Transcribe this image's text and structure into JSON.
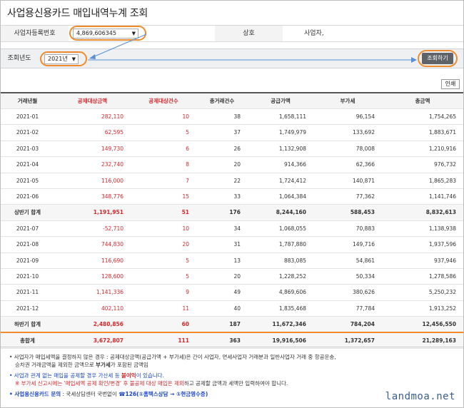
{
  "page": {
    "title": "사업용신용카드 매입내역누계 조회"
  },
  "search": {
    "biz_no_label": "사업자등록번호",
    "biz_no_value": "4,869,606345",
    "company_label": "상호",
    "company_value": "사업자,",
    "year_label": "조회년도",
    "year_value": "2021년",
    "search_button": "조회하기",
    "print_button": "인쇄"
  },
  "table": {
    "headers": [
      "거래년월",
      "공제대상금액",
      "공제대상건수",
      "총거래건수",
      "공급가액",
      "부가세",
      "총금액"
    ],
    "rows": [
      {
        "ym": "2021-01",
        "amt": "282,110",
        "cnt": "10",
        "total_cnt": "38",
        "supply": "1,658,111",
        "vat": "96,154",
        "total": "1,754,265",
        "type": "normal"
      },
      {
        "ym": "2021-02",
        "amt": "62,595",
        "cnt": "5",
        "total_cnt": "37",
        "supply": "1,749,979",
        "vat": "133,692",
        "total": "1,883,671",
        "type": "normal"
      },
      {
        "ym": "2021-03",
        "amt": "149,730",
        "cnt": "6",
        "total_cnt": "26",
        "supply": "1,132,908",
        "vat": "78,008",
        "total": "1,210,916",
        "type": "normal"
      },
      {
        "ym": "2021-04",
        "amt": "232,740",
        "cnt": "8",
        "total_cnt": "20",
        "supply": "914,366",
        "vat": "62,366",
        "total": "976,732",
        "type": "normal"
      },
      {
        "ym": "2021-05",
        "amt": "116,000",
        "cnt": "7",
        "total_cnt": "22",
        "supply": "1,724,412",
        "vat": "140,871",
        "total": "1,865,283",
        "type": "normal"
      },
      {
        "ym": "2021-06",
        "amt": "348,776",
        "cnt": "15",
        "total_cnt": "33",
        "supply": "1,064,384",
        "vat": "77,362",
        "total": "1,141,746",
        "type": "normal"
      },
      {
        "ym": "상반기 합계",
        "amt": "1,191,951",
        "cnt": "51",
        "total_cnt": "176",
        "supply": "8,244,160",
        "vat": "588,453",
        "total": "8,832,613",
        "type": "sum"
      },
      {
        "ym": "2021-07",
        "amt": "-52,710",
        "cnt": "10",
        "total_cnt": "34",
        "supply": "1,068,055",
        "vat": "70,883",
        "total": "1,138,938",
        "type": "normal"
      },
      {
        "ym": "2021-08",
        "amt": "744,830",
        "cnt": "20",
        "total_cnt": "31",
        "supply": "1,787,880",
        "vat": "149,716",
        "total": "1,937,596",
        "type": "normal"
      },
      {
        "ym": "2021-09",
        "amt": "116,690",
        "cnt": "5",
        "total_cnt": "13",
        "supply": "883,085",
        "vat": "54,861",
        "total": "937,946",
        "type": "normal"
      },
      {
        "ym": "2021-10",
        "amt": "128,600",
        "cnt": "5",
        "total_cnt": "20",
        "supply": "1,228,252",
        "vat": "50,334",
        "total": "1,278,586",
        "type": "normal"
      },
      {
        "ym": "2021-11",
        "amt": "1,141,336",
        "cnt": "9",
        "total_cnt": "49",
        "supply": "4,869,606",
        "vat": "380,626",
        "total": "5,250,232",
        "type": "normal"
      },
      {
        "ym": "2021-12",
        "amt": "402,110",
        "cnt": "11",
        "total_cnt": "40",
        "supply": "1,835,468",
        "vat": "77,784",
        "total": "1,913,252",
        "type": "normal"
      },
      {
        "ym": "하반기 합계",
        "amt": "2,480,856",
        "cnt": "60",
        "total_cnt": "187",
        "supply": "11,672,346",
        "vat": "784,204",
        "total": "12,456,550",
        "type": "sum-orange"
      },
      {
        "ym": "총합계",
        "amt": "3,672,807",
        "cnt": "111",
        "total_cnt": "363",
        "supply": "19,916,506",
        "vat": "1,372,657",
        "total": "21,289,163",
        "type": "sum"
      }
    ]
  },
  "notes": {
    "n1": "• 사업자가 매입세액을 결정하지 않은 경우 : 공제대상금액(공급가액 + 부가세)은 간이 사업자, 면세사업자 거래분과 일반사업자 거래 중 항공운송,",
    "n2_a": "승차권 거래금액을 제외한 금액으로 ",
    "n2_b": "부가세",
    "n2_c": "가 포함된 금액임",
    "n3_a": "• 사업과 관계 없는 매입을 공제할 경우 가산세 등 ",
    "n3_b": "불이익",
    "n3_c": "이 있습니다.",
    "n4_a": "※ 부가세 신고시에는 '매입세액 공제 확인/변경' 후 불공제 대상 매입은 제외",
    "n4_b": "하고 공제할 금액과 세액만 입력하여야 합니다.",
    "n5_a": "• 사업용신용카드 문의",
    "n5_b": " : 국세상담센터 국번없이 ",
    "n5_c": "☎126(①홈택스상담 → ①현금영수증)"
  },
  "watermark": "landmoa.net",
  "colors": {
    "accent": "#ef8b2c",
    "red": "#d6262b",
    "blue": "#1a44c6",
    "button": "#5f6368"
  }
}
